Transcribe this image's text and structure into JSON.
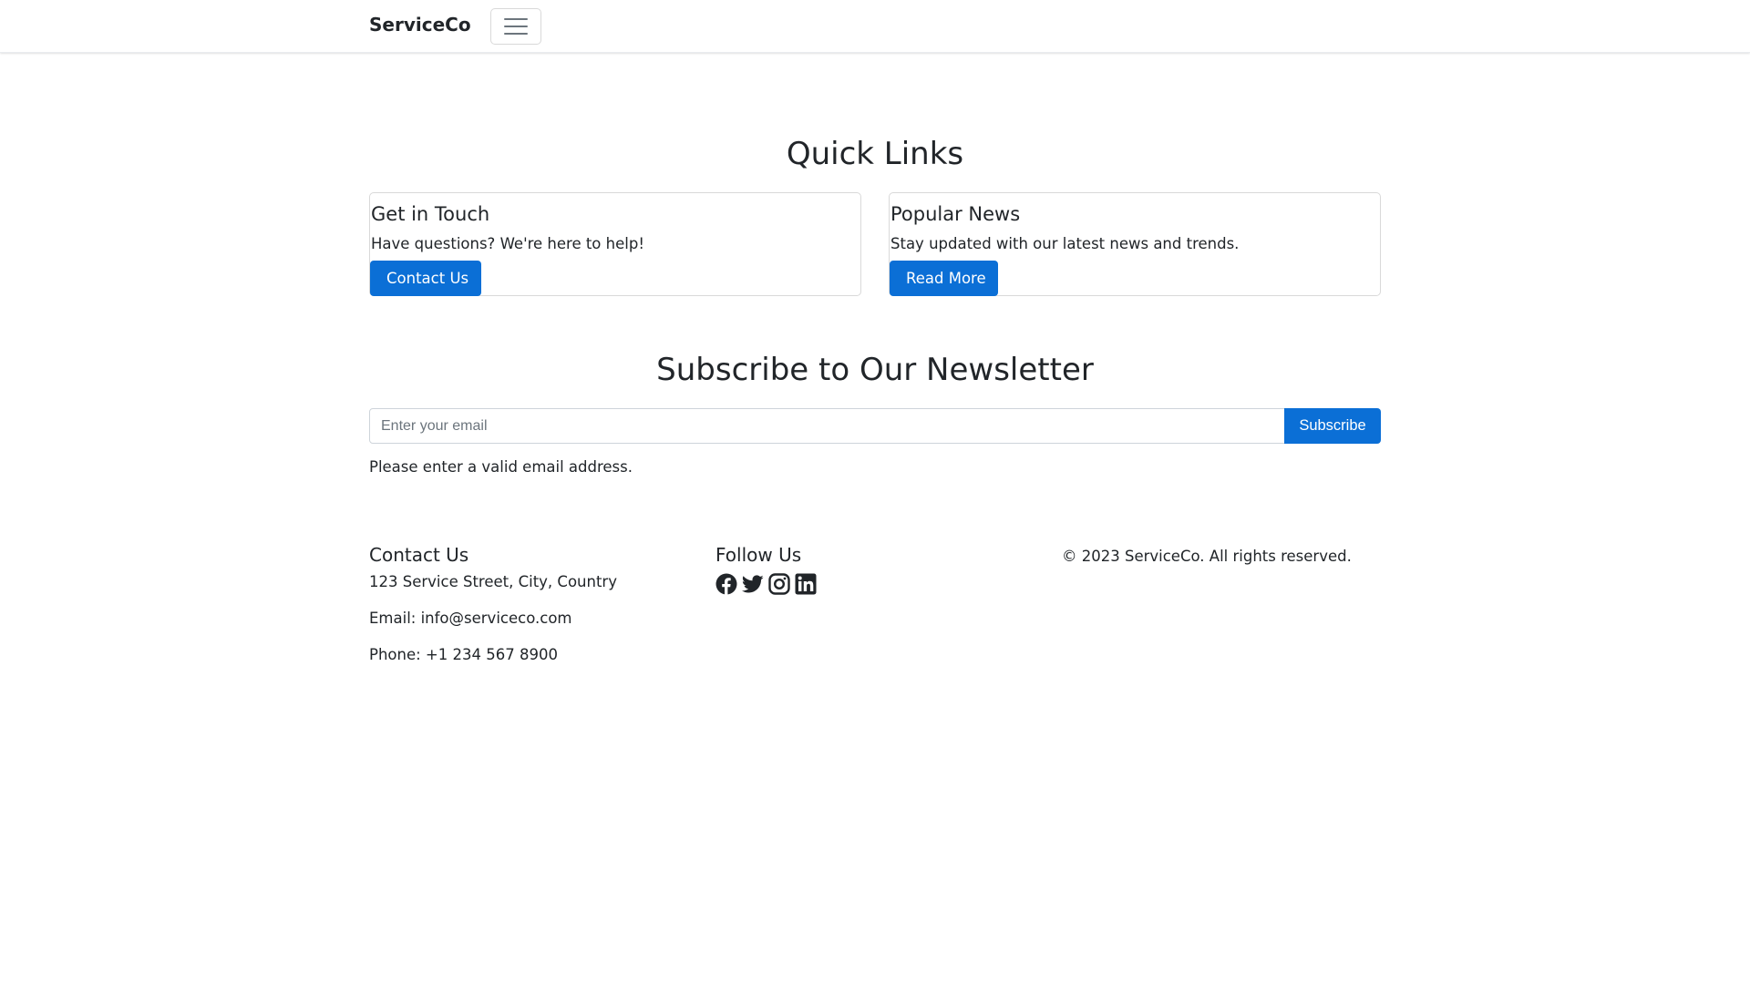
{
  "navbar": {
    "brand": "ServiceCo",
    "toggler_icon": "hamburger-menu-icon"
  },
  "quick_links": {
    "title": "Quick Links",
    "cards": [
      {
        "title": "Get in Touch",
        "text": "Have questions? We're here to help!",
        "button_label": "Contact Us"
      },
      {
        "title": "Popular News",
        "text": "Stay updated with our latest news and trends.",
        "button_label": "Read More"
      }
    ]
  },
  "newsletter": {
    "title": "Subscribe to Our Newsletter",
    "email_placeholder": "Enter your email",
    "email_value": "",
    "button_label": "Subscribe",
    "feedback": "Please enter a valid email address."
  },
  "footer": {
    "contact": {
      "heading": "Contact Us",
      "address": "123 Service Street, City, Country",
      "email": "Email: info@serviceco.com",
      "phone": "Phone: +1 234 567 8900"
    },
    "follow": {
      "heading": "Follow Us",
      "icons": [
        "facebook-icon",
        "twitter-icon",
        "instagram-icon",
        "linkedin-icon"
      ]
    },
    "copyright": "© 2023 ServiceCo. All rights reserved."
  },
  "colors": {
    "primary": "#0b6fd6",
    "text": "#212529",
    "border": "#dee2e6"
  }
}
